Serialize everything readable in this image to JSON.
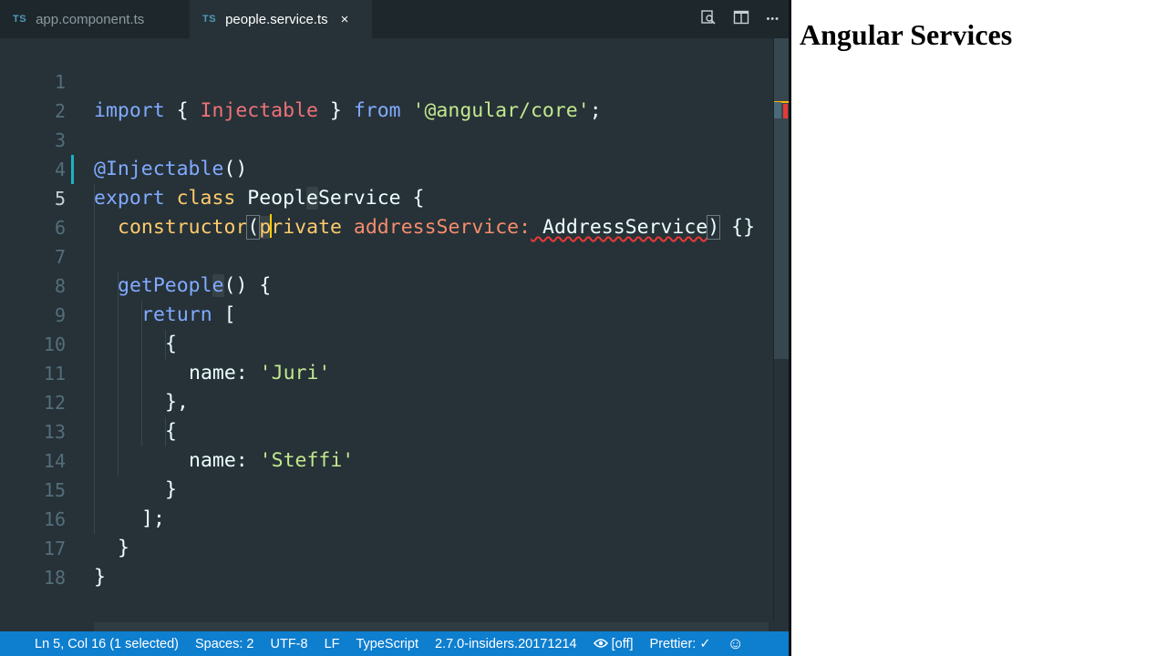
{
  "tabs": [
    {
      "badge": "TS",
      "label": "app.component.ts"
    },
    {
      "badge": "TS",
      "label": "people.service.ts",
      "close": "×"
    }
  ],
  "toolbar_icons": [
    "search-icon",
    "split-editor-icon",
    "more-actions-icon"
  ],
  "toolbar": {
    "more": "•••"
  },
  "code": {
    "line_numbers": [
      "1",
      "2",
      "3",
      "4",
      "5",
      "6",
      "7",
      "8",
      "9",
      "10",
      "11",
      "12",
      "13",
      "14",
      "15",
      "16",
      "17",
      "18"
    ],
    "l1": {
      "import": "import",
      "brace_open": " { ",
      "injectable": "Injectable",
      "brace_close": " } ",
      "from": "from",
      "module": " '@angular/core'",
      "semi": ";"
    },
    "l3": {
      "decorator": "@Injectable",
      "parens": "()"
    },
    "l4": {
      "export": "export",
      "class": " class ",
      "name_a": "Peopl",
      "name_b": "e",
      "name_c": "Service",
      "brace": " {"
    },
    "l5": {
      "ctor": "constructor",
      "paren": "(",
      "p": "p",
      "rivate": "rivate",
      "param": " addressService",
      "colon": ":",
      "type": " AddressService",
      "close": ")",
      "body": " {}"
    },
    "l7": {
      "fn_a": "getPeopl",
      "fn_b": "e",
      "paren": "()",
      "brace": " {"
    },
    "l8": {
      "ret": "return",
      "bracket": " ["
    },
    "l9": {
      "brace": "{"
    },
    "l10": {
      "key": "name",
      "colon": ":",
      "value": " 'Juri'"
    },
    "l11": {
      "text": "},"
    },
    "l12": {
      "brace": "{"
    },
    "l13": {
      "key": "name",
      "colon": ":",
      "value": " 'Steffi'"
    },
    "l14": {
      "brace": "}"
    },
    "l15": {
      "text": "];"
    },
    "l16": {
      "brace": "}"
    },
    "l17": {
      "brace": "}"
    }
  },
  "status": {
    "position": "Ln 5, Col 16 (1 selected)",
    "spaces": "Spaces: 2",
    "encoding": "UTF-8",
    "eol": "LF",
    "language": "TypeScript",
    "version": "2.7.0-insiders.20171214",
    "watch": "[off]",
    "prettier": "Prettier: ✓",
    "feedback": "☺"
  },
  "preview": {
    "title": "Angular Services"
  },
  "colors": {
    "statusbar": "#0e7ecf",
    "editor_bg": "#263238",
    "tab_bg": "#1e272c"
  }
}
